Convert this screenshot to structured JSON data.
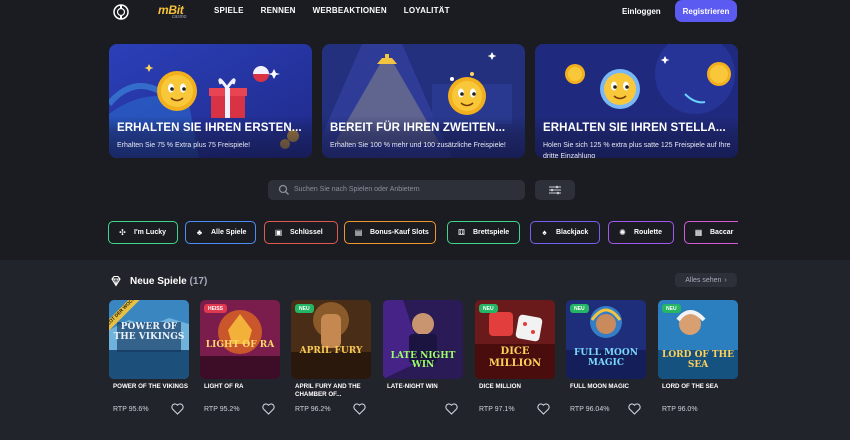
{
  "header": {
    "logo_text": "mBit",
    "logo_sub": "casino",
    "nav": [
      "SPIELE",
      "RENNEN",
      "WERBEAKTIONEN",
      "LOYALITÄT"
    ],
    "login_label": "Einloggen",
    "register_label": "Registrieren"
  },
  "promos": [
    {
      "title": "ERHALTEN SIE IHREN ERSTEN...",
      "desc": "Erhalten Sie 75 % Extra plus 75 Freispiele!"
    },
    {
      "title": "BEREIT FÜR IHREN ZWEITEN...",
      "desc": "Erhalten Sie 100 % mehr und 100 zusätzliche Freispiele!"
    },
    {
      "title": "ERHALTEN SIE IHREN STELLA...",
      "desc": "Holen Sie sich 125 % extra plus satte 125 Freispiele auf Ihre dritte Einzahlung"
    }
  ],
  "search": {
    "placeholder": "Suchen Sie nach Spielen oder Anbietern"
  },
  "categories": [
    {
      "label": "I'm Lucky",
      "color": "#3fd68a",
      "icon": "clover-icon"
    },
    {
      "label": "Alle Spiele",
      "color": "#4b8ef5",
      "icon": "cards-icon"
    },
    {
      "label": "Schlüssel",
      "color": "#e05a50",
      "icon": "slot-icon"
    },
    {
      "label": "Bonus-Kauf Slots",
      "color": "#f0962e",
      "icon": "bonus-icon"
    },
    {
      "label": "Brettspiele",
      "color": "#3fd68a",
      "icon": "board-icon"
    },
    {
      "label": "Blackjack",
      "color": "#6f62f0",
      "icon": "blackjack-icon"
    },
    {
      "label": "Roulette",
      "color": "#a15af0",
      "icon": "roulette-icon"
    },
    {
      "label": "Baccar",
      "color": "#d65ad6",
      "icon": "baccarat-icon"
    }
  ],
  "new_games": {
    "title": "Neue Spiele",
    "count": "(17)",
    "see_all": "Alles sehen",
    "games": [
      {
        "name": "POWER OF THE VIKINGS",
        "rtp": "RTP 95.6%",
        "art_title": "POWER OF THE VIKINGS",
        "ribbon": "SLOT DER WOCHE",
        "badge": ""
      },
      {
        "name": "LIGHT OF RA",
        "rtp": "RTP 95.2%",
        "art_title": "LIGHT OF RA",
        "ribbon": "",
        "badge": "HEISS"
      },
      {
        "name": "APRIL FURY AND THE CHAMBER OF...",
        "rtp": "RTP 96.2%",
        "art_title": "APRIL FURY",
        "ribbon": "",
        "badge": "NEU"
      },
      {
        "name": "LATE-NIGHT WIN",
        "rtp": "",
        "art_title": "LATE NIGHT WIN",
        "ribbon": "",
        "badge": ""
      },
      {
        "name": "DICE MILLION",
        "rtp": "RTP 97.1%",
        "art_title": "DICE MILLION",
        "ribbon": "",
        "badge": "NEU"
      },
      {
        "name": "FULL MOON MAGIC",
        "rtp": "RTP 96.04%",
        "art_title": "FULL MOON MAGIC",
        "ribbon": "",
        "badge": "NEU"
      },
      {
        "name": "LORD OF THE SEA",
        "rtp": "RTP 96.0%",
        "art_title": "LORD OF THE SEA",
        "ribbon": "",
        "badge": "NEU"
      }
    ]
  }
}
